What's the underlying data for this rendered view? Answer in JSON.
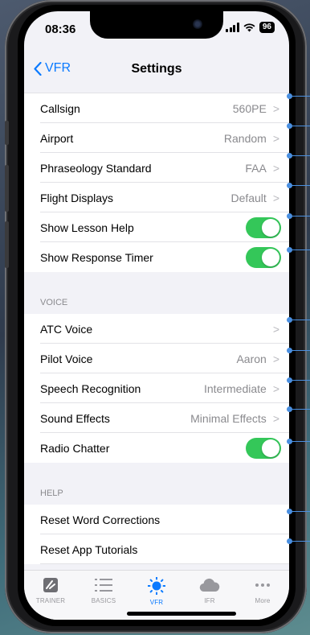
{
  "status": {
    "time": "08:36",
    "battery": "96"
  },
  "nav": {
    "back_label": "VFR",
    "title": "Settings"
  },
  "general": [
    {
      "label": "Callsign",
      "value": "560PE",
      "type": "disclosure"
    },
    {
      "label": "Airport",
      "value": "Random",
      "type": "disclosure"
    },
    {
      "label": "Phraseology Standard",
      "value": "FAA",
      "type": "disclosure"
    },
    {
      "label": "Flight Displays",
      "value": "Default",
      "type": "disclosure"
    },
    {
      "label": "Show Lesson Help",
      "type": "toggle",
      "on": true
    },
    {
      "label": "Show Response Timer",
      "type": "toggle",
      "on": true
    }
  ],
  "voice": {
    "header": "VOICE",
    "rows": [
      {
        "label": "ATC Voice",
        "value": "",
        "type": "disclosure"
      },
      {
        "label": "Pilot Voice",
        "value": "Aaron",
        "type": "disclosure"
      },
      {
        "label": "Speech Recognition",
        "value": "Intermediate",
        "type": "disclosure"
      },
      {
        "label": "Sound Effects",
        "value": "Minimal Effects",
        "type": "disclosure"
      },
      {
        "label": "Radio Chatter",
        "type": "toggle",
        "on": true
      }
    ]
  },
  "help": {
    "header": "HELP",
    "rows": [
      {
        "label": "Reset Word Corrections",
        "type": "action"
      },
      {
        "label": "Reset App Tutorials",
        "type": "action"
      }
    ]
  },
  "tabs": [
    {
      "label": "TRAINER",
      "icon": "trainer-icon",
      "active": false
    },
    {
      "label": "BASICS",
      "icon": "list-icon",
      "active": false
    },
    {
      "label": "VFR",
      "icon": "sun-icon",
      "active": true
    },
    {
      "label": "IFR",
      "icon": "cloud-icon",
      "active": false
    },
    {
      "label": "More",
      "icon": "more-icon",
      "active": false
    }
  ],
  "colors": {
    "accent": "#0a7aff",
    "toggle_on": "#34c759",
    "connector": "#4a8fe0"
  }
}
